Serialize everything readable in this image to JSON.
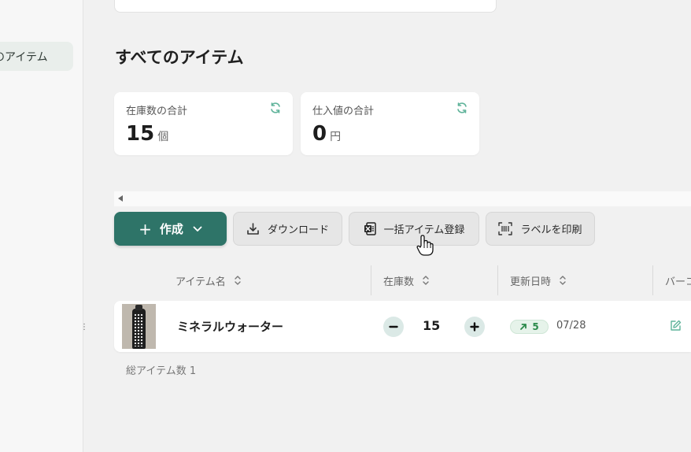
{
  "sidebar": {
    "active_item": "のアイテム"
  },
  "search": {
    "placeholder": ""
  },
  "top_link": "",
  "page_title": "すべてのアイテム",
  "summary_cards": [
    {
      "label": "在庫数の合計",
      "value": "15",
      "unit": "個"
    },
    {
      "label": "仕入値の合計",
      "value": "0",
      "unit": "円"
    }
  ],
  "toolbar": {
    "create_label": "作成",
    "download_label": "ダウンロード",
    "bulk_register_label": "一括アイテム登録",
    "print_label_label": "ラベルを印刷"
  },
  "table": {
    "columns": [
      "アイテム名",
      "在庫数",
      "更新日時",
      "バーコ"
    ],
    "rows": [
      {
        "name": "ミネラルウォーター",
        "quantity": "15",
        "change": "5",
        "updated": "07/28"
      }
    ]
  },
  "total_items": "総アイテム数 1",
  "colors": {
    "primary": "#2e7468",
    "accent_green": "#2b8a4a",
    "background": "#f1f1f1"
  }
}
